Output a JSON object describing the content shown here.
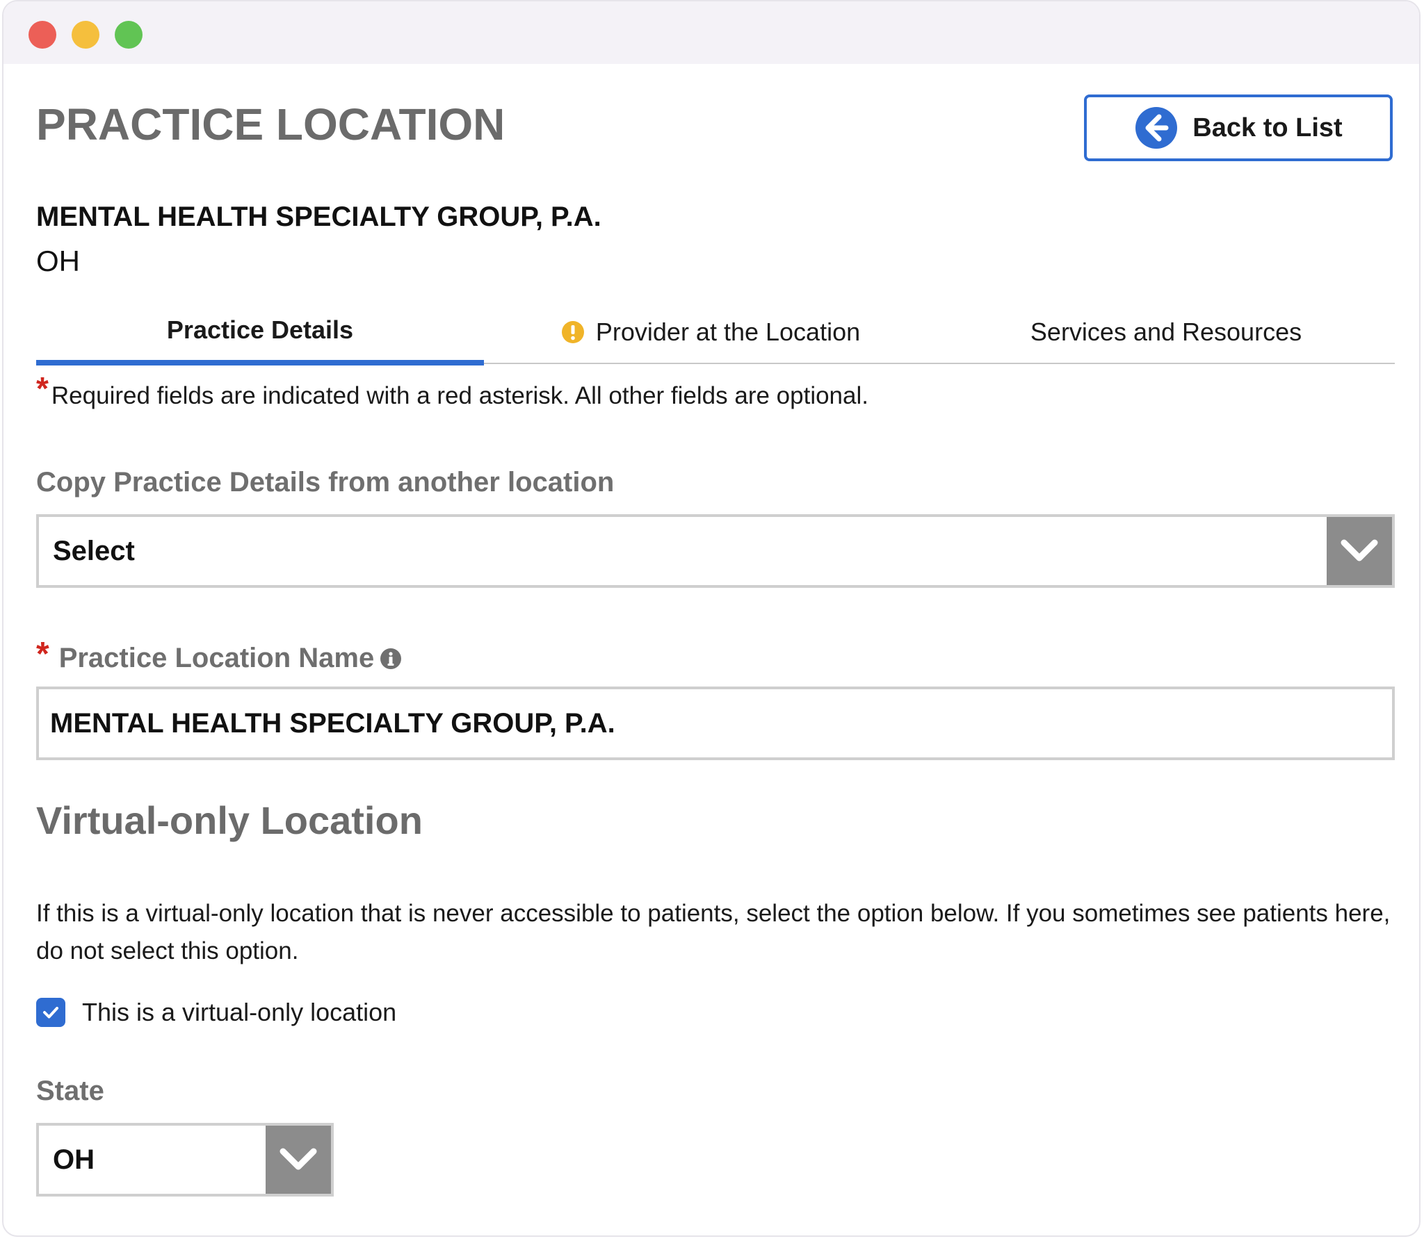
{
  "window": {
    "controls": [
      "close-button",
      "minimize-button",
      "zoom-button"
    ]
  },
  "header": {
    "title": "PRACTICE LOCATION",
    "back_label": "Back to List"
  },
  "organization": {
    "name": "MENTAL HEALTH SPECIALTY GROUP, P.A.",
    "state": "OH"
  },
  "tabs": [
    {
      "label": "Practice Details",
      "active": true
    },
    {
      "label": "Provider at the Location",
      "icon": "warning-icon"
    },
    {
      "label": "Services and Resources"
    }
  ],
  "required_note": {
    "star": "*",
    "text": "Required fields are indicated with a red asterisk. All other fields are optional."
  },
  "copy_details": {
    "label": "Copy Practice Details from another location",
    "selected": "Select"
  },
  "location_name": {
    "star": "*",
    "label": "Practice Location Name",
    "value": "MENTAL HEALTH SPECIALTY GROUP, P.A."
  },
  "virtual": {
    "title": "Virtual-only Location",
    "description": "If this is a virtual-only location that is never accessible to patients, select the option below. If you sometimes see patients here, do not select this option.",
    "checkbox_label": "This is a virtual-only location",
    "checked": true
  },
  "state_field": {
    "label": "State",
    "selected": "OH"
  },
  "colors": {
    "accent": "#2f6cd1",
    "required": "#d0261e",
    "warning": "#f0b429",
    "muted_heading": "#6b6b6b"
  }
}
